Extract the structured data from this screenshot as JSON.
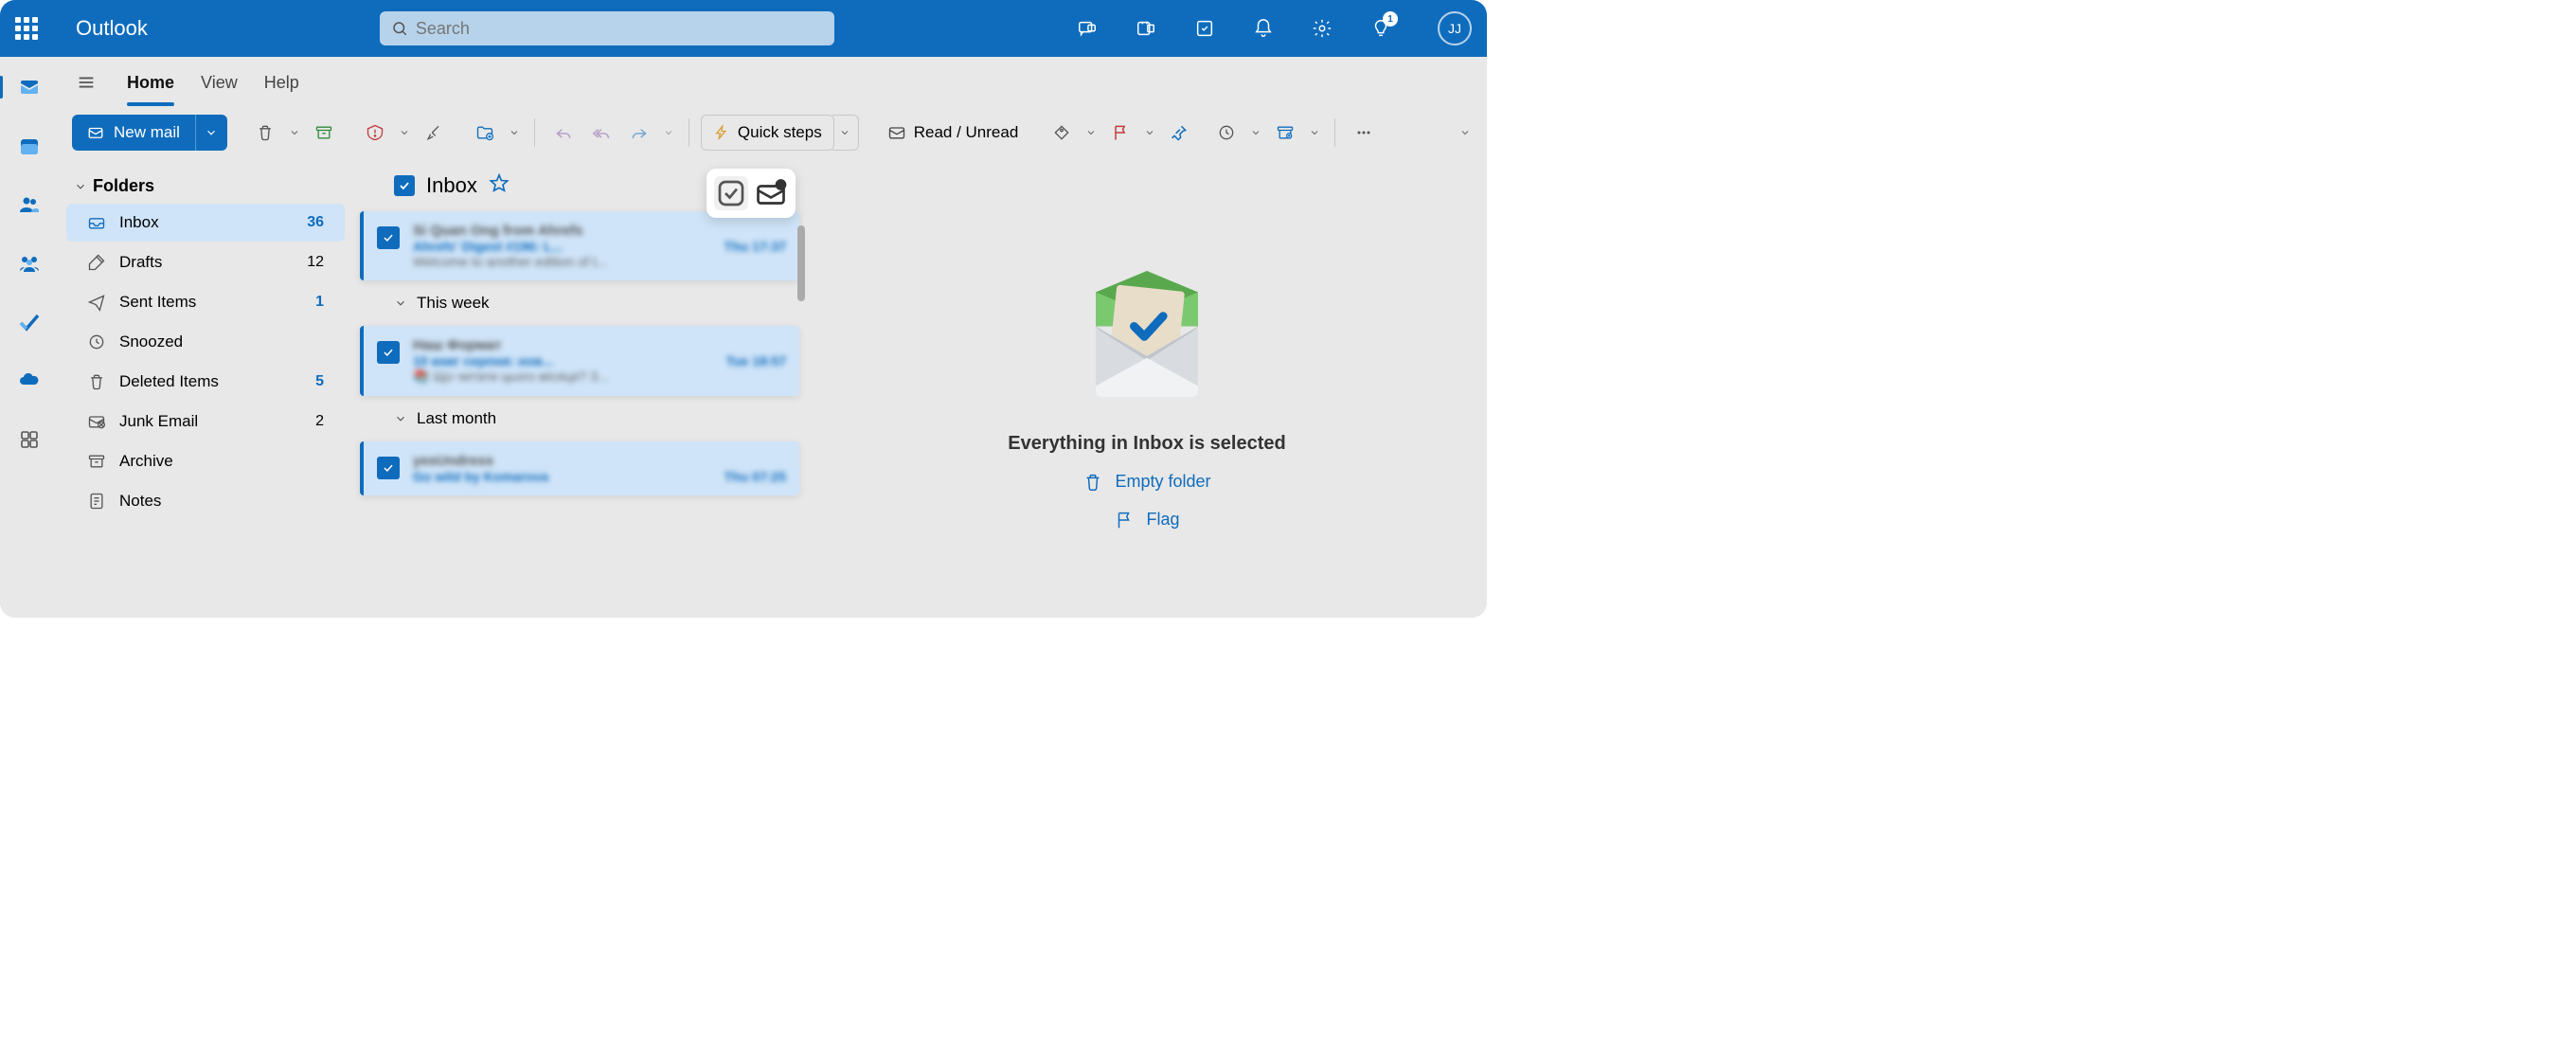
{
  "header": {
    "app_title": "Outlook",
    "search_placeholder": "Search",
    "tips_badge": "1",
    "avatar_initials": "JJ"
  },
  "tabs": {
    "home": "Home",
    "view": "View",
    "help": "Help"
  },
  "toolbar": {
    "new_mail": "New mail",
    "quick_steps": "Quick steps",
    "read_unread": "Read / Unread"
  },
  "folders": {
    "header": "Folders",
    "items": [
      {
        "label": "Inbox",
        "count": "36",
        "icon": "inbox",
        "active": true,
        "bold": true
      },
      {
        "label": "Drafts",
        "count": "12",
        "icon": "drafts"
      },
      {
        "label": "Sent Items",
        "count": "1",
        "icon": "sent",
        "bold": true
      },
      {
        "label": "Snoozed",
        "count": "",
        "icon": "snoozed"
      },
      {
        "label": "Deleted Items",
        "count": "5",
        "icon": "deleted",
        "bold": true
      },
      {
        "label": "Junk Email",
        "count": "2",
        "icon": "junk"
      },
      {
        "label": "Archive",
        "count": "",
        "icon": "archive"
      },
      {
        "label": "Notes",
        "count": "",
        "icon": "notes"
      }
    ]
  },
  "msglist": {
    "title": "Inbox",
    "groups": [
      "This week",
      "Last month"
    ],
    "messages": [
      {
        "sender": "Si Quan Ong from Ahrefs",
        "subject": "Ahrefs' Digest #196: L...",
        "time": "Thu 17:37",
        "preview": "Welcome to another edition of t..."
      },
      {
        "sender": "Наш Формат",
        "subject": "10 книг серпня: нов...",
        "time": "Tue 18:57",
        "preview": "📚 Що читати цього місяця? 3..."
      },
      {
        "sender": "yesUndress",
        "subject": "Go wild by Komarova",
        "time": "Thu 07:25",
        "preview": ""
      }
    ]
  },
  "reading": {
    "title": "Everything in Inbox is selected",
    "empty_folder": "Empty folder",
    "flag": "Flag"
  }
}
